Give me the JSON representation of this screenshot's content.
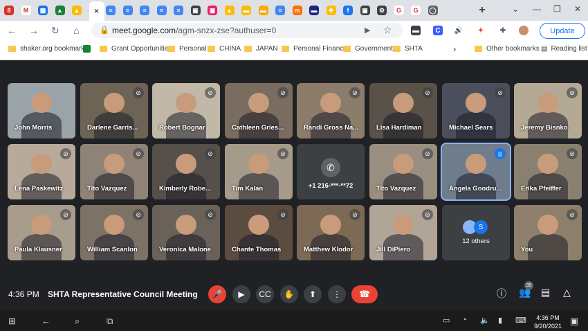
{
  "browser": {
    "tab_icons": [
      "8",
      "M",
      "▦",
      "▲",
      "▲",
      "✕",
      "≡",
      "≡",
      "≡",
      "≡",
      "≡",
      "▣",
      "▣",
      "▲",
      "▬",
      "▬",
      "≡",
      "m",
      "▬",
      "✚",
      "f",
      "▣",
      "⚙",
      "G",
      "G",
      "◯"
    ],
    "new_tab": "+",
    "url_host": "meet.google.com",
    "url_path": "/agm-snzx-zse?authuser=0",
    "update_label": "Update"
  },
  "bookmarks": {
    "items": [
      {
        "label": "shaker.org bookmarks"
      },
      {
        "label": ""
      },
      {
        "label": "Grant Opportunities"
      },
      {
        "label": "Personal"
      },
      {
        "label": "CHINA"
      },
      {
        "label": "JAPAN"
      },
      {
        "label": "Personal Finance"
      },
      {
        "label": "Government"
      },
      {
        "label": "SHTA"
      }
    ],
    "other": "Other bookmarks",
    "reading": "Reading list"
  },
  "participants": [
    {
      "name": "John Morris",
      "bg": "#9aa3a8"
    },
    {
      "name": "Darlene Garris...",
      "bg": "#6e6455"
    },
    {
      "name": "Robert Bognar",
      "bg": "#c2b8a8"
    },
    {
      "name": "Cathleen Gries...",
      "bg": "#7a6c5e"
    },
    {
      "name": "Randi Gross Na...",
      "bg": "#8c7d6b"
    },
    {
      "name": "Lisa Hardiman",
      "bg": "#5a5148"
    },
    {
      "name": "Michael Sears",
      "bg": "#4b4f5c"
    },
    {
      "name": "Jeremy Bisnko",
      "bg": "#b3a994"
    },
    {
      "name": "Lena Paskewitz",
      "bg": "#b8aa9a"
    },
    {
      "name": "Tito Vazquez",
      "bg": "#8f8377"
    },
    {
      "name": "Kimberly Robe...",
      "bg": "#55504a"
    },
    {
      "name": "Tim Kalan",
      "bg": "#a69a8a"
    },
    {
      "name": "+1 216-***-**72",
      "bg": "#3c4043"
    },
    {
      "name": "Tito Vazquez",
      "bg": "#9a8e80"
    },
    {
      "name": "Angela Goodru...",
      "bg": "#6f7d8c"
    },
    {
      "name": "Erika Pfeiffer",
      "bg": "#8a8070"
    },
    {
      "name": "Paula Klausner",
      "bg": "#a89c8c"
    },
    {
      "name": "William Scanlon",
      "bg": "#7d7266"
    },
    {
      "name": "Veronica Malone",
      "bg": "#6a6258"
    },
    {
      "name": "Chante Thomas",
      "bg": "#5c4c40"
    },
    {
      "name": "Matthew Klodor",
      "bg": "#7c6a55"
    },
    {
      "name": "Jill DiPiero",
      "bg": "#b1a598"
    },
    {
      "name": "12 others",
      "bg": "#3c4043"
    },
    {
      "name": "You",
      "bg": "#8d7f6c"
    }
  ],
  "meeting": {
    "time": "4:36 PM",
    "title": "SHTA Representative Council Meeting",
    "people_count": "35"
  },
  "taskbar": {
    "time": "4:36 PM",
    "date": "9/20/2021"
  }
}
